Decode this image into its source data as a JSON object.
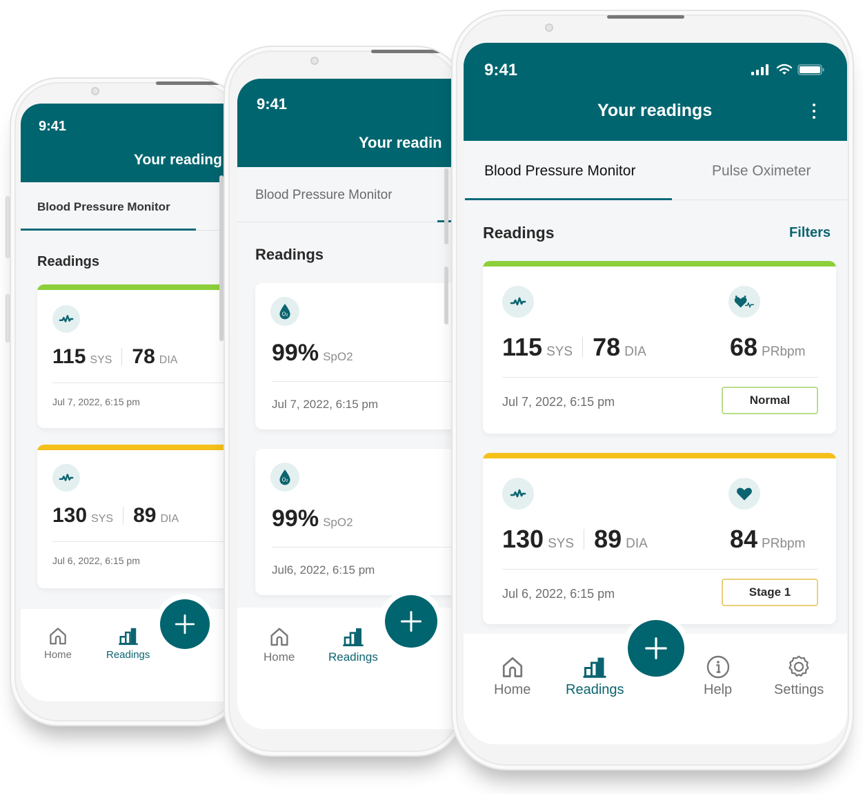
{
  "colors": {
    "brand": "#00656f",
    "normal": "#8ccf3a",
    "stage1": "#f5c01a",
    "icon_bg": "#e4eff0"
  },
  "status_bar": {
    "time": "9:41",
    "icons": [
      "signal-icon",
      "wifi-icon",
      "battery-icon"
    ]
  },
  "app_bar": {
    "title": "Your readings",
    "title_truncated_back": "Your reading",
    "title_truncated_mid": "Your readin",
    "menu_icon": "kebab-menu-icon"
  },
  "tabs": [
    {
      "label": "Blood Pressure Monitor",
      "active": true
    },
    {
      "label": "Pulse Oximeter",
      "active": false
    }
  ],
  "section": {
    "title": "Readings",
    "filters_label": "Filters"
  },
  "bp_readings": [
    {
      "systolic": "115",
      "sys_label": "SYS",
      "diastolic": "78",
      "dia_label": "DIA",
      "pulse": "68",
      "pulse_label": "PRbpm",
      "date": "Jul 7, 2022, 6:15 pm",
      "status": "Normal",
      "status_color": "#8ccf3a",
      "bp_icon": "heartbeat-wave-icon",
      "pulse_icon": "heart-pulse-icon"
    },
    {
      "systolic": "130",
      "sys_label": "SYS",
      "diastolic": "89",
      "dia_label": "DIA",
      "pulse": "84",
      "pulse_label": "PRbpm",
      "date": "Jul 6, 2022, 6:15 pm",
      "status": "Stage 1",
      "status_color": "#f5c01a",
      "bp_icon": "heartbeat-wave-icon",
      "pulse_icon": "heart-icon"
    }
  ],
  "spo2_readings": [
    {
      "value": "99%",
      "label": "SpO2",
      "date": "Jul 7, 2022, 6:15 pm",
      "icon": "oxygen-drop-icon"
    },
    {
      "value": "99%",
      "label": "SpO2",
      "date": "Jul6, 2022, 6:15 pm",
      "icon": "oxygen-drop-icon"
    }
  ],
  "bottom_nav": {
    "items": [
      {
        "label": "Home",
        "icon": "home-icon",
        "active": false
      },
      {
        "label": "Readings",
        "icon": "bar-chart-icon",
        "active": true
      },
      {
        "label": "Help",
        "icon": "info-icon",
        "active": false
      },
      {
        "label": "Settings",
        "icon": "gear-icon",
        "active": false
      }
    ],
    "fab_icon": "plus-icon"
  }
}
